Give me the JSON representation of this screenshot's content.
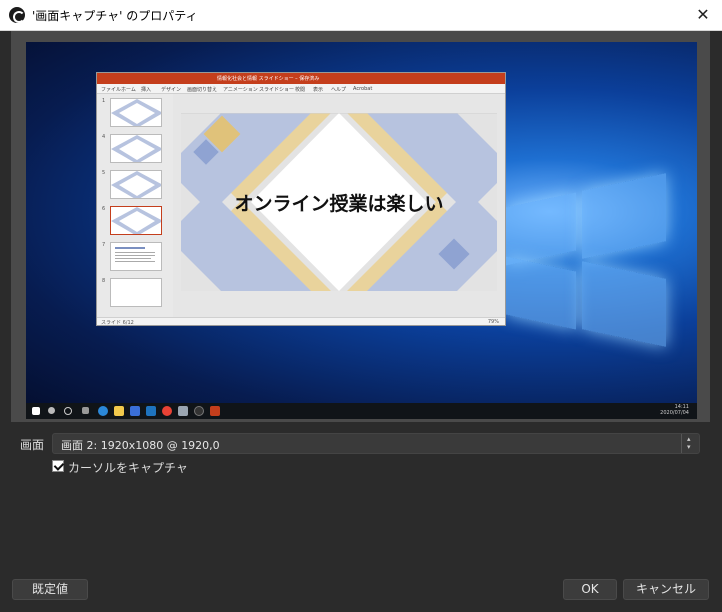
{
  "window": {
    "title": "'画面キャプチャ' のプロパティ",
    "close_symbol": "✕"
  },
  "preview": {
    "powerpoint": {
      "title_text": "情報化社会と情報 スライドショー – 保存済み",
      "ribbon_tabs": [
        "ファイル",
        "ホーム",
        "挿入",
        "デザイン",
        "画面切り替え",
        "アニメーション",
        "スライドショー",
        "校閲",
        "表示",
        "ヘルプ",
        "Acrobat"
      ],
      "slide_numbers": [
        "1",
        "4",
        "5",
        "6",
        "7",
        "8"
      ],
      "thumb_texts": [
        "情報化社会と情報",
        "情報化社会",
        "ご挨拶",
        "オンライン授業は楽しい"
      ],
      "slide_title": "オンライン授業は楽しい",
      "status_left": "スライド 6/12",
      "status_zoom": "79%"
    },
    "taskbar": {
      "clock_time": "14:11",
      "clock_date": "2020/07/04"
    }
  },
  "form": {
    "display_label": "画面",
    "display_value": "画面 2: 1920x1080 @ 1920,0",
    "cursor_capture_label": "カーソルをキャプチャ",
    "cursor_capture_checked": true
  },
  "buttons": {
    "defaults": "既定値",
    "ok": "OK",
    "cancel": "キャンセル"
  },
  "colors": {
    "dialog_bg": "#2b2b2b",
    "ppt_accent": "#c43e1c",
    "slide_blue": "#b7c3df",
    "slide_gold": "#e9d39c"
  }
}
